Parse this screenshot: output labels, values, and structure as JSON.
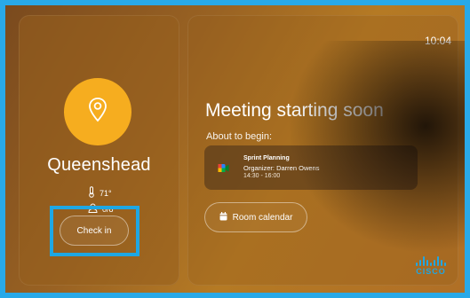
{
  "clock": "10:04",
  "room": {
    "name": "Queenshead",
    "temperature": "71°",
    "capacity": "0/8",
    "checkin_label": "Check in"
  },
  "status": {
    "headline": "Meeting starting soon",
    "subhead": "About to begin:"
  },
  "meeting": {
    "title": "Sprint Planning",
    "organizer": "Organizer: Darren Owens",
    "time": "14:30 - 16:00"
  },
  "calendar_button_label": "Room calendar",
  "brand": {
    "name": "CISCO",
    "color": "#1ea7e4"
  },
  "colors": {
    "accent_badge": "#f6ad1f",
    "highlight_border": "#1ea7e4"
  },
  "icons": [
    "location-pin-icon",
    "thermometer-icon",
    "person-icon",
    "google-meet-icon",
    "calendar-icon"
  ]
}
